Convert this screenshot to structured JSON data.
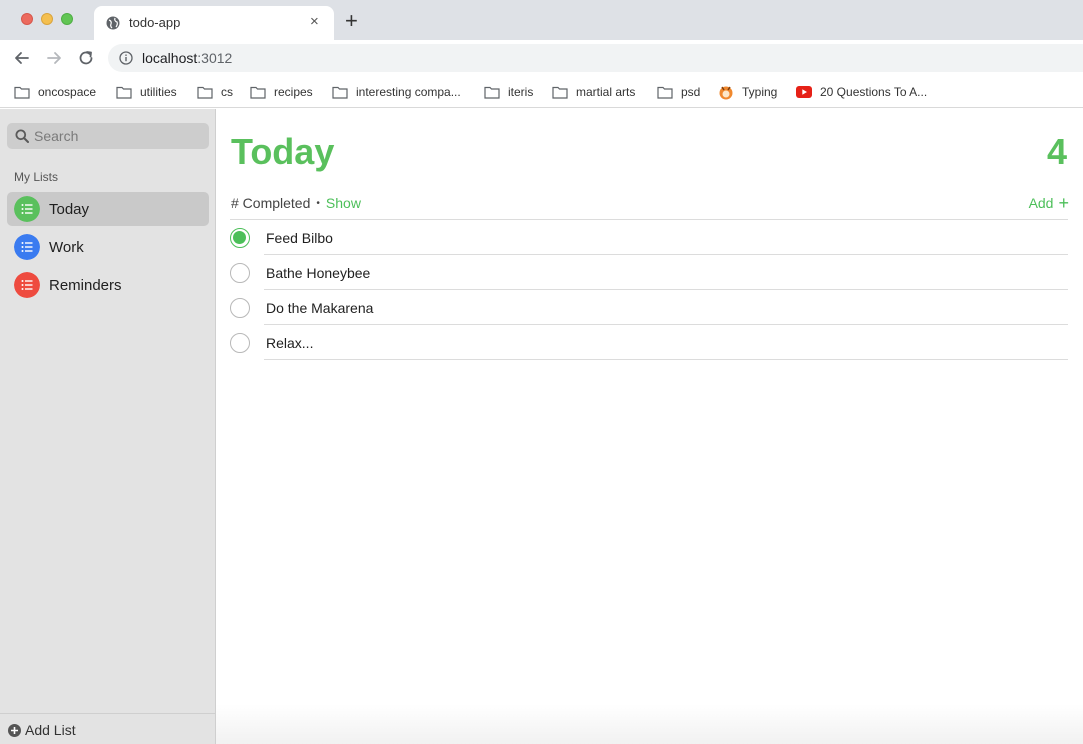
{
  "browser": {
    "tab_title": "todo-app",
    "tab_close": "×",
    "new_tab": "+",
    "url_host": "localhost",
    "url_port": ":3012",
    "bookmarks": [
      {
        "label": "oncospace",
        "icon": "folder-icon"
      },
      {
        "label": "utilities",
        "icon": "folder-icon"
      },
      {
        "label": "cs",
        "icon": "folder-icon"
      },
      {
        "label": "recipes",
        "icon": "folder-icon"
      },
      {
        "label": "interesting compa...",
        "icon": "folder-icon"
      },
      {
        "label": "iteris",
        "icon": "folder-icon"
      },
      {
        "label": "martial arts",
        "icon": "folder-icon"
      },
      {
        "label": "psd",
        "icon": "folder-icon"
      },
      {
        "label": "Typing",
        "icon": "typing-favicon"
      },
      {
        "label": "20 Questions To A...",
        "icon": "youtube-icon"
      }
    ]
  },
  "sidebar": {
    "search_placeholder": "Search",
    "section_title": "My Lists",
    "lists": [
      {
        "label": "Today",
        "color": "#5ac05d",
        "selected": true
      },
      {
        "label": "Work",
        "color": "#3a7bf0",
        "selected": false
      },
      {
        "label": "Reminders",
        "color": "#ee4b3f",
        "selected": false
      }
    ],
    "add_list_label": "Add List"
  },
  "main": {
    "title": "Today",
    "count": "4",
    "completed_label": "# Completed",
    "separator": "•",
    "show_label": "Show",
    "add_label": "Add",
    "add_plus": "+",
    "accent_color": "#5ac05d",
    "todos": [
      {
        "text": "Feed Bilbo",
        "done": true
      },
      {
        "text": "Bathe Honeybee",
        "done": false
      },
      {
        "text": "Do the Makarena",
        "done": false
      },
      {
        "text": "Relax...",
        "done": false
      }
    ]
  }
}
